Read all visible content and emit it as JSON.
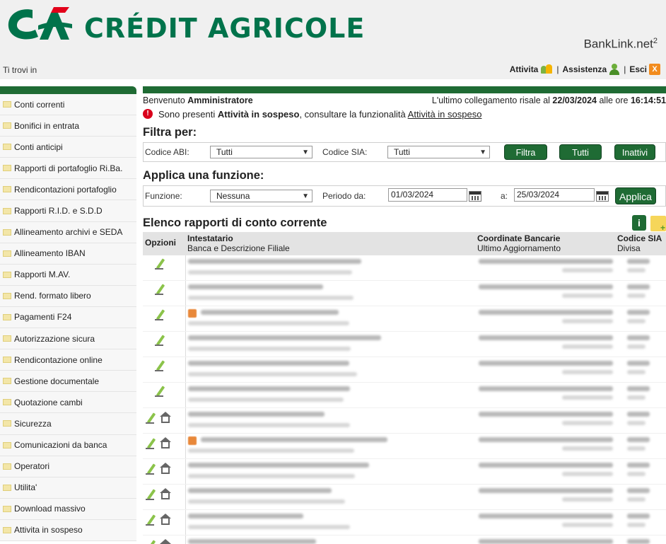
{
  "header": {
    "brand": "CRÉDIT AGRICOLE",
    "product": "BankLink.net",
    "product_sup": "2",
    "breadcrumb": "Ti trovi in",
    "links": {
      "activities": "Attivita",
      "separator": "|",
      "assistance": "Assistenza",
      "exit": "Esci",
      "exit_icon_glyph": "X"
    },
    "colors": {
      "brand_green": "#00734b",
      "brand_red": "#e2001a",
      "dark_green": "#1f6b34"
    }
  },
  "sidebar": {
    "items": [
      {
        "label": "Conti correnti"
      },
      {
        "label": "Bonifici in entrata"
      },
      {
        "label": "Conti anticipi"
      },
      {
        "label": "Rapporti di portafoglio Ri.Ba."
      },
      {
        "label": "Rendicontazioni portafoglio"
      },
      {
        "label": "Rapporti R.I.D. e S.D.D"
      },
      {
        "label": "Allineamento archivi e SEDA"
      },
      {
        "label": "Allineamento IBAN"
      },
      {
        "label": "Rapporti M.AV."
      },
      {
        "label": "Rend. formato libero"
      },
      {
        "label": "Pagamenti F24"
      },
      {
        "label": "Autorizzazione sicura"
      },
      {
        "label": "Rendicontazione online"
      },
      {
        "label": "Gestione documentale"
      },
      {
        "label": "Quotazione cambi"
      },
      {
        "label": "Sicurezza"
      },
      {
        "label": "Comunicazioni da banca"
      },
      {
        "label": "Operatori"
      },
      {
        "label": "Utilita'"
      },
      {
        "label": "Download massivo"
      },
      {
        "label": "Attivita in sospeso"
      }
    ]
  },
  "welcome": {
    "prefix": "Benvenuto",
    "user": "Amministratore",
    "last_login_prefix": "L'ultimo collegamento risale al",
    "last_login_date": "22/03/2024",
    "last_login_mid": "alle ore",
    "last_login_time": "16:14:51"
  },
  "alert": {
    "icon_glyph": "!",
    "text_before": "Sono presenti",
    "text_bold": "Attività in sospeso",
    "text_after": ", consultare la funzionalità",
    "link": "Attività in sospeso"
  },
  "filter": {
    "title": "Filtra per:",
    "abi_label": "Codice ABI:",
    "abi_value": "Tutti",
    "sia_label": "Codice SIA:",
    "sia_value": "Tutti",
    "buttons": {
      "filter": "Filtra",
      "all": "Tutti",
      "inactive": "Inattivi"
    }
  },
  "function": {
    "title": "Applica una funzione:",
    "function_label": "Funzione:",
    "function_value": "Nessuna",
    "period_from_label": "Periodo da:",
    "period_from": "01/03/2024",
    "period_to_label": "a:",
    "period_to": "25/03/2024",
    "apply": "Applica"
  },
  "list": {
    "title": "Elenco rapporti di conto corrente",
    "info_glyph": "i",
    "columns": {
      "options": "Opzioni",
      "holder": "Intestatario",
      "holder_sub": "Banca e Descrizione Filiale",
      "coords": "Coordinate Bancarie",
      "coords_sub": "Ultimo Aggiornamento",
      "sia": "Codice SIA",
      "sia_sub": "Divisa"
    },
    "caret_glyph": "▼"
  }
}
